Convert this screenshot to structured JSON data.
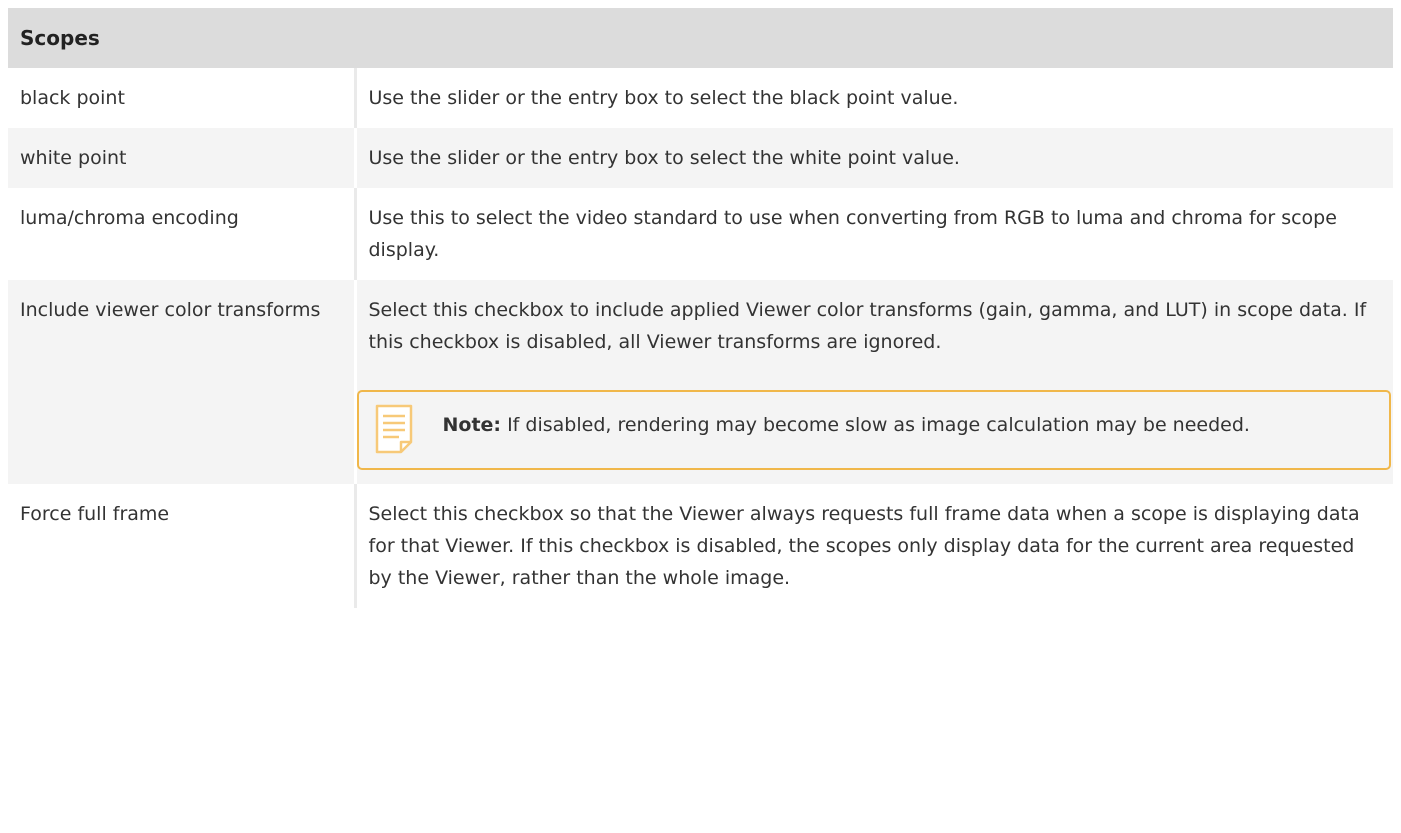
{
  "table": {
    "header": "Scopes",
    "rows": [
      {
        "name": "black point",
        "description": "Use the slider or the entry box to select the black point value."
      },
      {
        "name": "white point",
        "description": "Use the slider or the entry box to select the white point value."
      },
      {
        "name": "luma/chroma encoding",
        "description": "Use this to select the video standard to use when converting from RGB to luma and chroma for scope display."
      },
      {
        "name": "Include viewer color transforms",
        "description": "Select this checkbox to include applied Viewer color transforms (gain, gamma, and LUT) in scope data. If this checkbox is disabled, all Viewer transforms are ignored.",
        "note": {
          "icon": "note-icon",
          "label": "Note:",
          "text": " If disabled, rendering may become slow as image calculation may be needed."
        }
      },
      {
        "name": "Force full frame",
        "description": "Select this checkbox so that the Viewer always requests full frame data when a scope is displaying data for that Viewer. If this checkbox is disabled, the scopes only display data for the current area requested by the Viewer, rather than the whole image."
      }
    ]
  },
  "colors": {
    "header_bg": "#dcdcdc",
    "row_alt_bg": "#f4f4f4",
    "note_border": "#f0b74a",
    "note_icon": "#f7c978"
  }
}
